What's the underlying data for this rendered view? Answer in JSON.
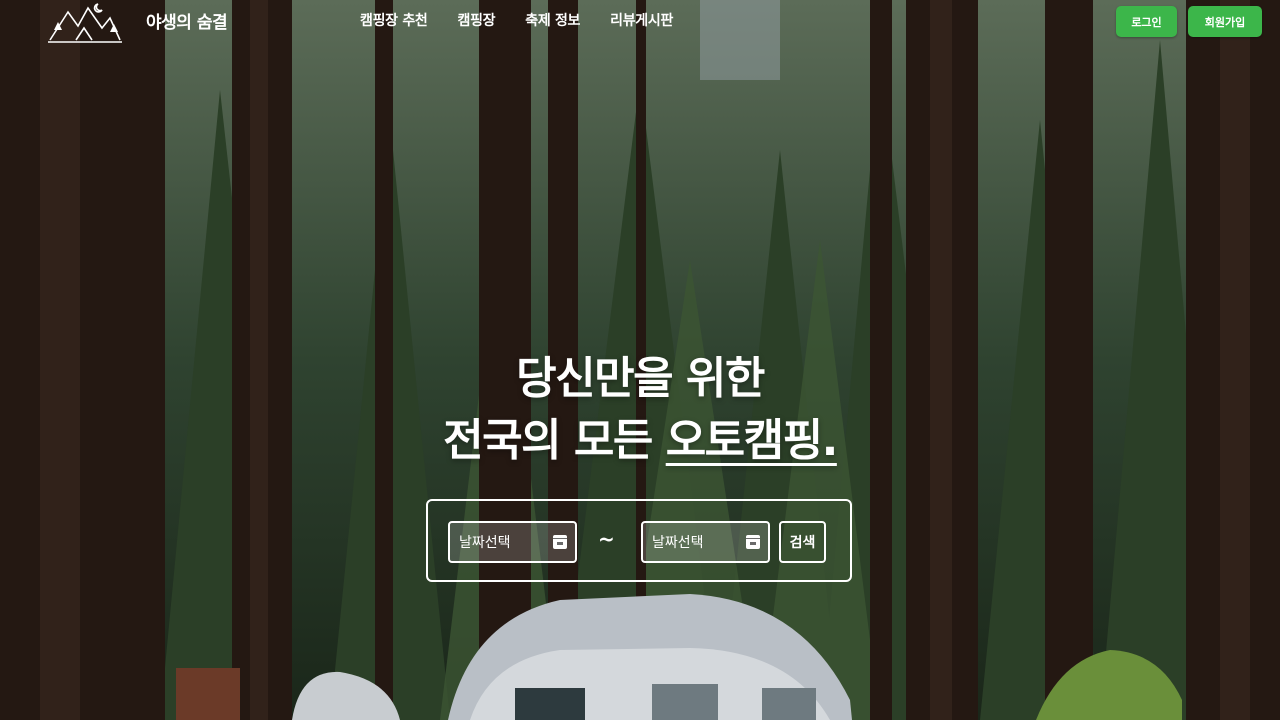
{
  "brand": {
    "name": "야생의 숨결",
    "logo_icon": "mountain-camp-logo-icon"
  },
  "nav": {
    "items": [
      {
        "label": "캠핑장 추천"
      },
      {
        "label": "캠핑장"
      },
      {
        "label": "축제 정보"
      },
      {
        "label": "리뷰게시판"
      }
    ]
  },
  "auth": {
    "login_label": "로그인",
    "signup_label": "회원가입",
    "button_color": "#3cb64a"
  },
  "hero": {
    "line1": "당신만을 위한",
    "line2_prefix": "전국의 모든 ",
    "line2_highlight": "오토캠핑."
  },
  "search": {
    "start_date_placeholder": "날짜선택",
    "end_date_placeholder": "날짜선택",
    "separator": "~",
    "button_label": "검색",
    "calendar_icon": "calendar-icon"
  }
}
